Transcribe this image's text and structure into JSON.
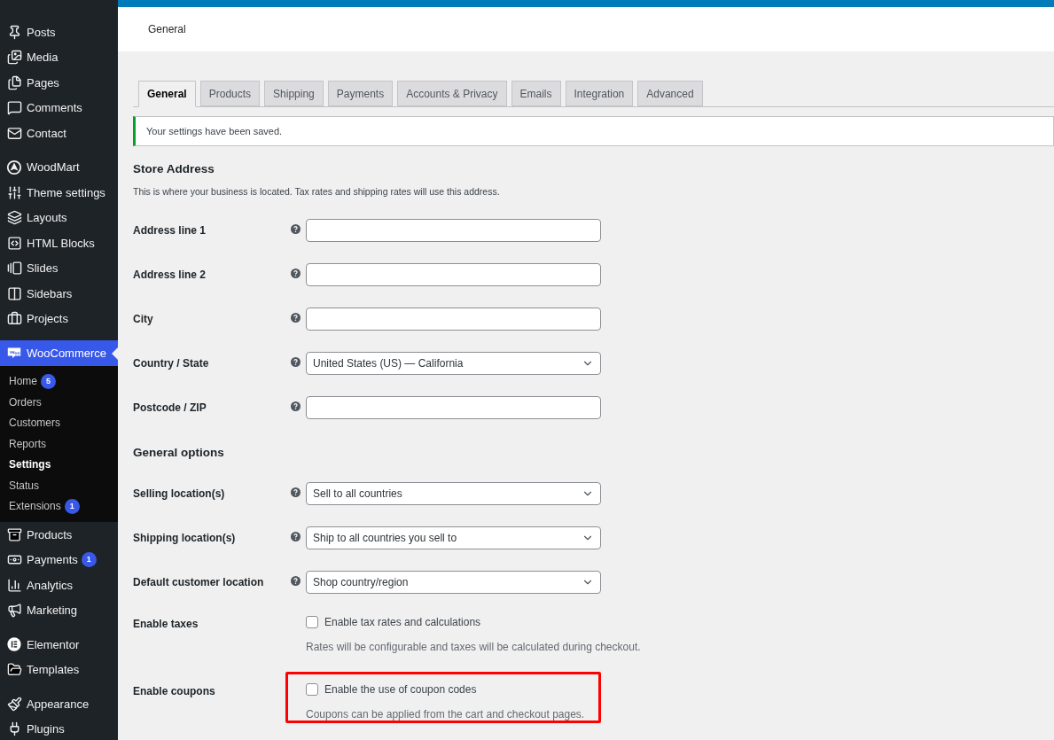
{
  "sidebar": {
    "groups": [
      [
        {
          "label": "Posts",
          "selected": false
        },
        {
          "label": "Media",
          "selected": false
        },
        {
          "label": "Pages",
          "selected": false
        },
        {
          "label": "Comments",
          "selected": false
        },
        {
          "label": "Contact",
          "selected": false
        }
      ],
      [
        {
          "label": "WoodMart",
          "selected": false
        },
        {
          "label": "Theme settings",
          "selected": false
        },
        {
          "label": "Layouts",
          "selected": false
        },
        {
          "label": "HTML Blocks",
          "selected": false
        },
        {
          "label": "Slides",
          "selected": false
        },
        {
          "label": "Sidebars",
          "selected": false
        },
        {
          "label": "Projects",
          "selected": false
        }
      ],
      [
        {
          "label": "WooCommerce",
          "selected": true,
          "children": [
            {
              "label": "Home",
              "selected": false,
              "badge": "5"
            },
            {
              "label": "Orders",
              "selected": false
            },
            {
              "label": "Customers",
              "selected": false
            },
            {
              "label": "Reports",
              "selected": false
            },
            {
              "label": "Settings",
              "selected": true
            },
            {
              "label": "Status",
              "selected": false
            },
            {
              "label": "Extensions",
              "selected": false,
              "badge": "1"
            }
          ]
        },
        {
          "label": "Products",
          "selected": false
        },
        {
          "label": "Payments",
          "selected": false,
          "badge": "1"
        },
        {
          "label": "Analytics",
          "selected": false
        },
        {
          "label": "Marketing",
          "selected": false
        }
      ],
      [
        {
          "label": "Elementor",
          "selected": false
        },
        {
          "label": "Templates",
          "selected": false
        }
      ],
      [
        {
          "label": "Appearance",
          "selected": false
        },
        {
          "label": "Plugins",
          "selected": false
        }
      ]
    ]
  },
  "header": {
    "title": "General"
  },
  "tabs": [
    {
      "label": "General",
      "selected": true
    },
    {
      "label": "Products",
      "selected": false
    },
    {
      "label": "Shipping",
      "selected": false
    },
    {
      "label": "Payments",
      "selected": false
    },
    {
      "label": "Accounts & Privacy",
      "selected": false
    },
    {
      "label": "Emails",
      "selected": false
    },
    {
      "label": "Integration",
      "selected": false
    },
    {
      "label": "Advanced",
      "selected": false
    }
  ],
  "notice": {
    "text": "Your settings have been saved."
  },
  "sections": [
    {
      "title": "Store Address",
      "description": "This is where your business is located. Tax rates and shipping rates will use this address.",
      "fields": [
        {
          "kind": "text",
          "label": "Address line 1",
          "help": true
        },
        {
          "kind": "text",
          "label": "Address line 2",
          "help": true
        },
        {
          "kind": "text",
          "label": "City",
          "help": true
        },
        {
          "kind": "select",
          "label": "Country / State",
          "help": true,
          "value": "United States (US) — California"
        },
        {
          "kind": "text",
          "label": "Postcode / ZIP",
          "help": true
        }
      ]
    },
    {
      "title": "General options",
      "fields": [
        {
          "kind": "select",
          "label": "Selling location(s)",
          "help": true,
          "value": "Sell to all countries"
        },
        {
          "kind": "select",
          "label": "Shipping location(s)",
          "help": true,
          "value": "Ship to all countries you sell to"
        },
        {
          "kind": "select",
          "label": "Default customer location",
          "help": true,
          "value": "Shop country/region"
        },
        {
          "kind": "checkbox",
          "label": "Enable taxes",
          "help": false,
          "option": "Enable tax rates and calculations",
          "checked": false,
          "description": "Rates will be configurable and taxes will be calculated during checkout.",
          "highlighted": false
        },
        {
          "kind": "checkbox",
          "label": "Enable coupons",
          "help": false,
          "option": "Enable the use of coupon codes",
          "checked": false,
          "description": "Coupons can be applied from the cart and checkout pages.",
          "highlighted": true
        }
      ]
    }
  ]
}
